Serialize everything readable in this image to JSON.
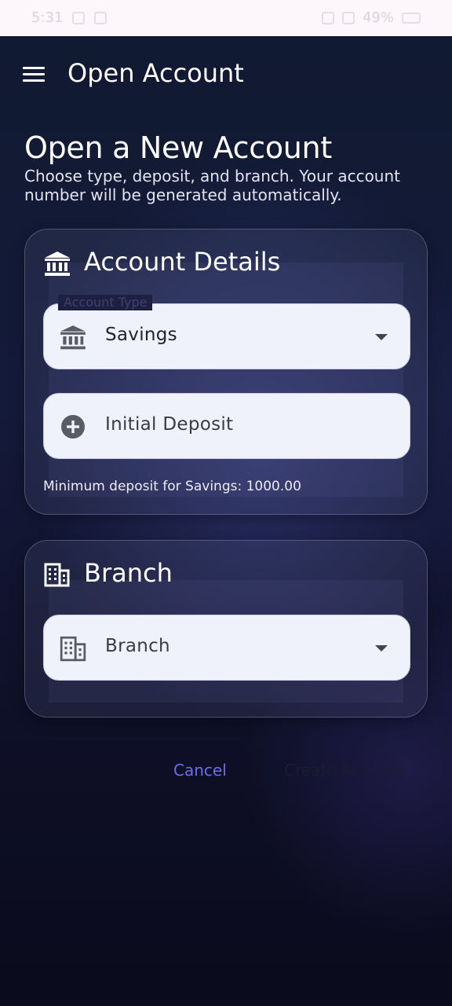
{
  "status_bar": {
    "time": "5:31",
    "battery": "49%"
  },
  "app_bar": {
    "title": "Open Account",
    "menu_icon": "menu-icon"
  },
  "heading": "Open a New Account",
  "subheading": "Choose type, deposit, and branch. Your account number will be generated automatically.",
  "account_details_card": {
    "title": "Account Details",
    "icon": "bank-icon",
    "account_type": {
      "label": "Account Type",
      "value": "Savings",
      "icon": "bank-icon"
    },
    "initial_deposit": {
      "placeholder": "Initial Deposit",
      "icon": "add-circle-icon"
    },
    "helper": "Minimum deposit for Savings: 1000.00"
  },
  "branch_card": {
    "title": "Branch",
    "icon": "building-icon",
    "branch_select": {
      "placeholder": "Branch",
      "icon": "building-icon"
    }
  },
  "actions": {
    "cancel_label": "Cancel",
    "create_label": "Create Account"
  },
  "colors": {
    "accent": "#6c6cf0",
    "field_background": "#eff1fb",
    "status_bar_background": "#fdf7fb",
    "page_background": "#0d1024"
  }
}
